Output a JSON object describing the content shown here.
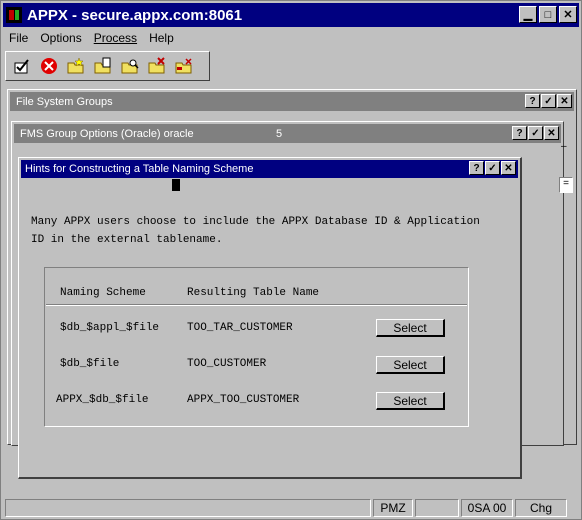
{
  "app": {
    "title": "APPX - secure.appx.com:8061"
  },
  "menubar": {
    "items": [
      "File",
      "Options",
      "Process",
      "Help"
    ]
  },
  "toolbar": {
    "icons": [
      "ok-check-icon",
      "cancel-icon",
      "folder-new-icon",
      "folder-edit-icon",
      "folder-search-icon",
      "folder-delete-icon",
      "folder-cancel-icon"
    ]
  },
  "windows": {
    "file_system_groups": {
      "title": "File System Groups"
    },
    "fms_group_options": {
      "title": "FMS Group Options (Oracle)  oracle",
      "number": "5"
    }
  },
  "dialog": {
    "title": "Hints for Constructing a Table Naming Scheme",
    "hint_line1": "Many APPX users choose to include the APPX Database ID & Application",
    "hint_line2": "ID in the external tablename.",
    "columns": {
      "scheme": "Naming Scheme",
      "result": "Resulting Table Name"
    },
    "rows": [
      {
        "scheme": "$db_$appl_$file",
        "result": "TOO_TAR_CUSTOMER",
        "button": "Select"
      },
      {
        "scheme": "$db_$file",
        "result": "TOO_CUSTOMER",
        "button": "Select"
      },
      {
        "scheme": "APPX_$db_$file",
        "result": "APPX_TOO_CUSTOMER",
        "button": "Select"
      }
    ]
  },
  "statusbar": {
    "cells": [
      "PMZ",
      "0SA 00",
      "Chg"
    ]
  },
  "colors": {
    "active_title": "#000080",
    "inactive_title": "#808080",
    "face": "#c0c0c0"
  }
}
